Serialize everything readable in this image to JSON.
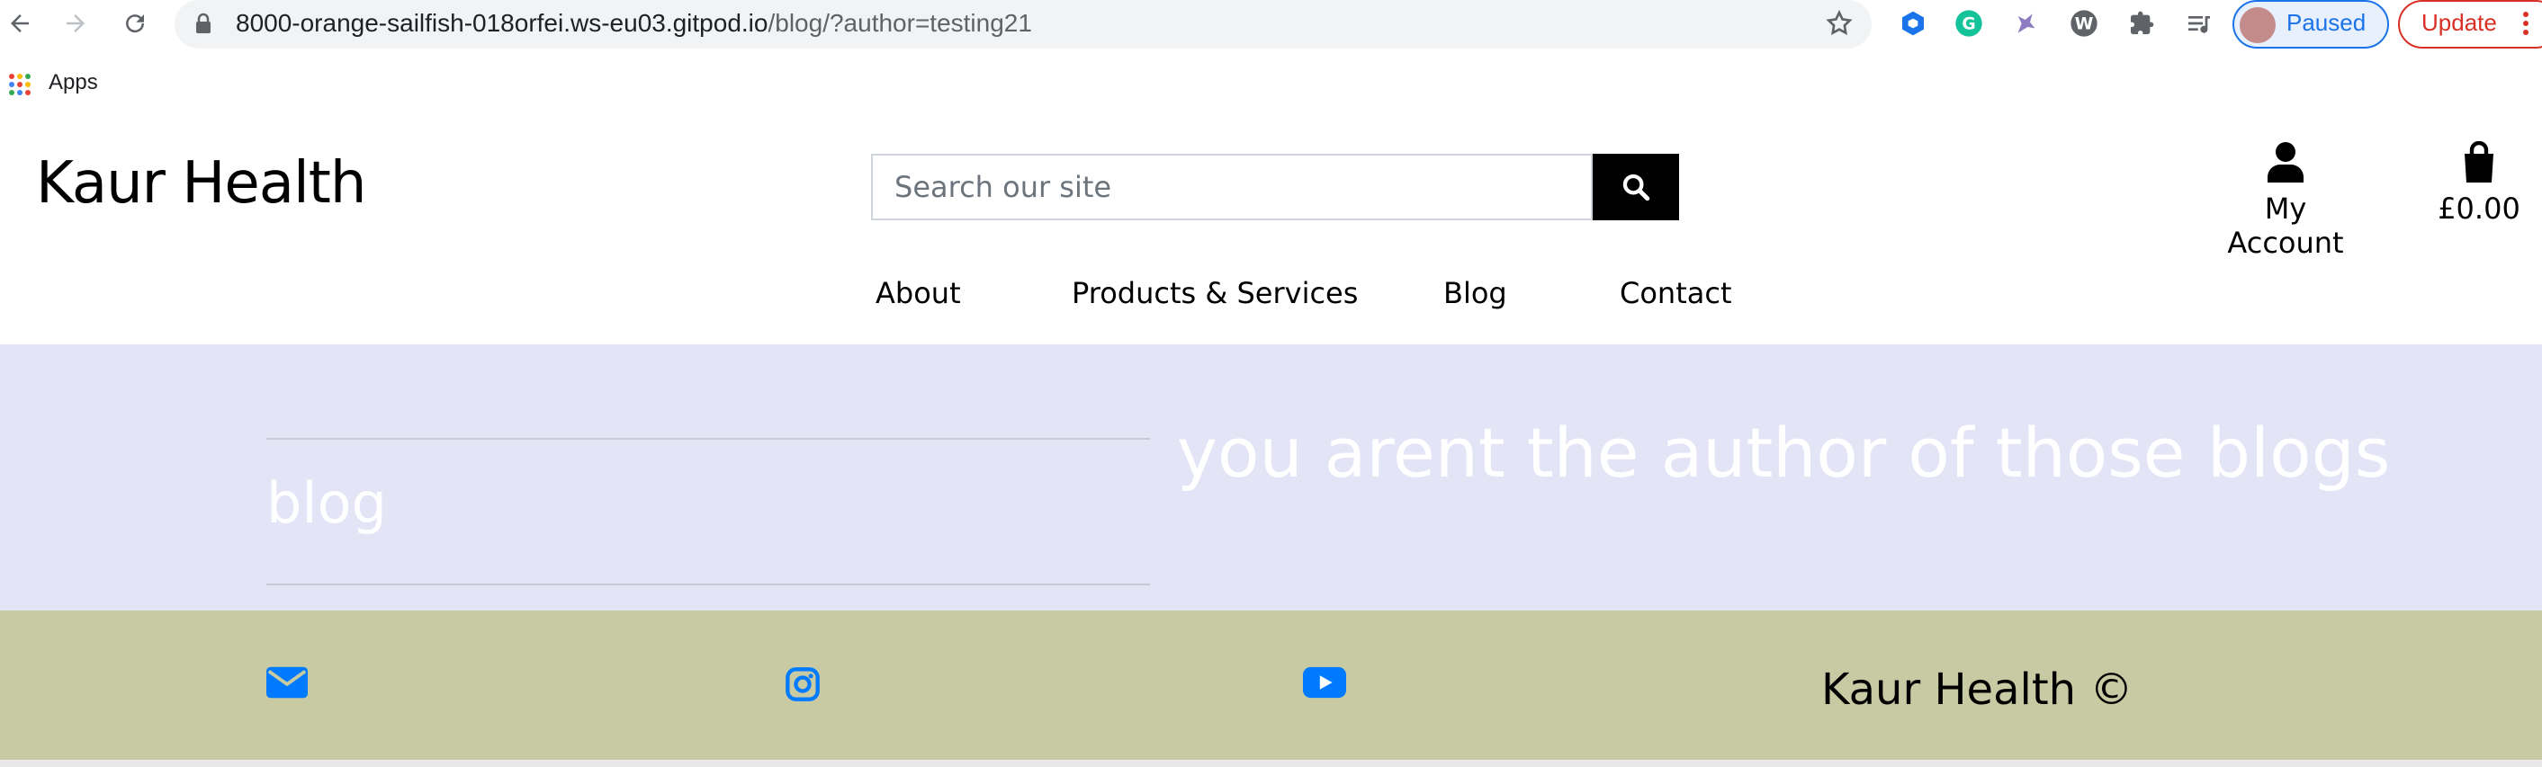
{
  "browser": {
    "url_host": "8000-orange-sailfish-018orfei.ws-eu03.gitpod.io",
    "url_path": "/blog/?author=testing21",
    "profile_label": "Paused",
    "update_label": "Update",
    "bookmarks": {
      "apps_label": "Apps"
    },
    "icons": [
      "back-arrow-icon",
      "forward-arrow-icon",
      "reload-icon",
      "lock-icon",
      "star-icon",
      "extension-icon",
      "grammarly-icon",
      "unicorn-icon",
      "wordpress-icon",
      "puzzle-icon",
      "reading-list-icon",
      "kebab-menu-icon"
    ]
  },
  "site": {
    "brand": "Kaur Health",
    "search": {
      "placeholder": "Search our site"
    },
    "account_label": "My Account",
    "cart_total": "£0.00",
    "nav": [
      "About",
      "Products & Services",
      "Blog",
      "Contact"
    ]
  },
  "main": {
    "heading": "blog",
    "message": "you arent the author of those blogs"
  },
  "footer": {
    "copyright": "Kaur Health ©",
    "icons": [
      "envelope-icon",
      "instagram-icon",
      "youtube-icon"
    ]
  },
  "colors": {
    "content_bg": "#e4e4f7",
    "footer_bg": "#c8caa3",
    "footer_icon": "#007bff",
    "chrome_blue": "#1a73e8",
    "chrome_red": "#d93025"
  }
}
